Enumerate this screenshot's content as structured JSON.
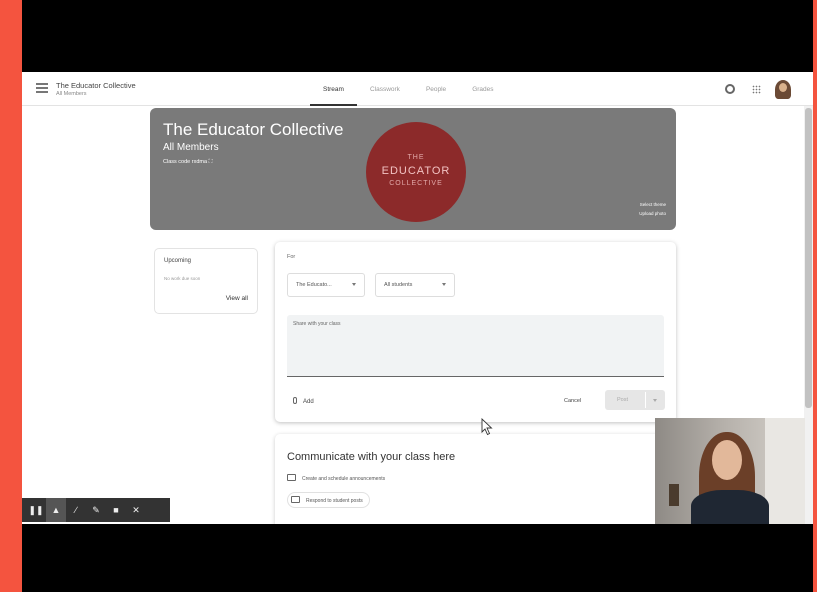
{
  "app": {
    "class_title": "The Educator Collective",
    "class_subtitle": "All Members"
  },
  "tabs": [
    {
      "label": "Stream",
      "active": true
    },
    {
      "label": "Classwork",
      "active": false
    },
    {
      "label": "People",
      "active": false
    },
    {
      "label": "Grades",
      "active": false
    }
  ],
  "banner": {
    "title": "The Educator Collective",
    "subtitle": "All Members",
    "class_code_label": "Class code",
    "class_code": "rxdma",
    "badge_line1": "THE",
    "badge_line2": "EDUCATOR",
    "badge_line3": "COLLECTIVE",
    "select_theme": "Select theme",
    "upload_photo": "Upload photo",
    "color": "#7a7a7a",
    "badge_color": "#8c2a2a"
  },
  "upcoming": {
    "heading": "Upcoming",
    "note": "No work due soon",
    "view_all": "View all"
  },
  "composer": {
    "for_label": "For",
    "class_select": "The Educato...",
    "students_select": "All students",
    "share_placeholder": "Share with your class",
    "add_label": "Add",
    "cancel_label": "Cancel",
    "post_label": "Post"
  },
  "communicate": {
    "title": "Communicate with your class here",
    "item1": "Create and schedule announcements",
    "item2": "Respond to student posts"
  },
  "icons": {
    "menu": "menu-icon",
    "settings": "gear-icon",
    "apps": "apps-grid-icon",
    "attach": "paperclip-icon"
  },
  "toolbar": {
    "tools": [
      "pause",
      "pointer",
      "pen",
      "highlighter",
      "camera",
      "close"
    ]
  }
}
